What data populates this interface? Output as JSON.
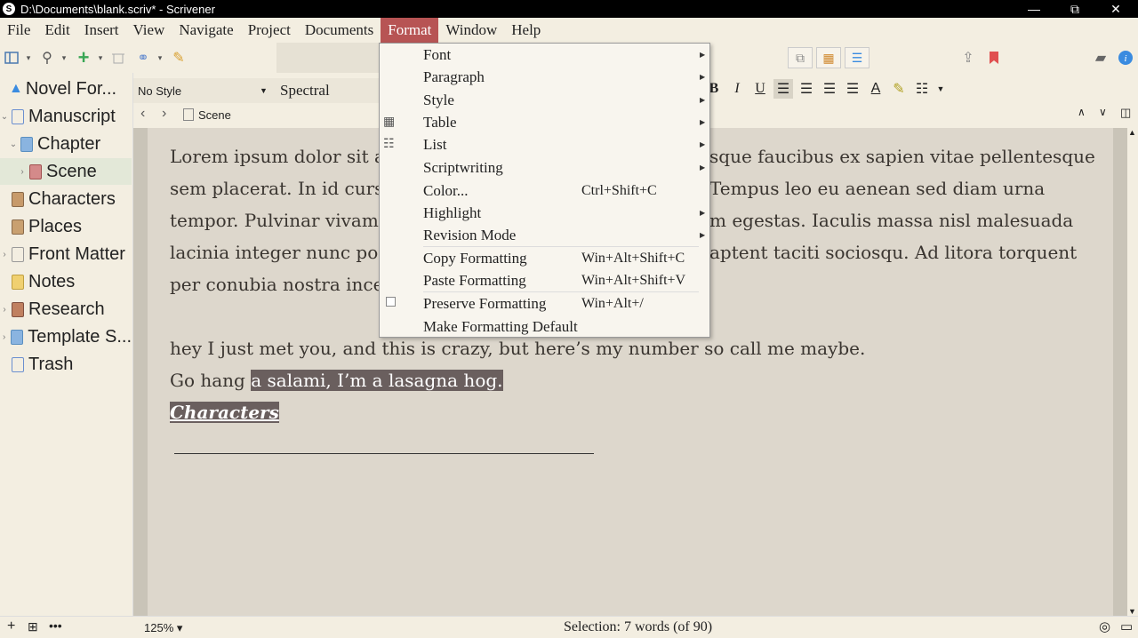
{
  "window": {
    "title": "D:\\Documents\\blank.scriv* - Scrivener",
    "minimize": "—",
    "maximize": "⧉",
    "close": "✕"
  },
  "menubar": [
    "File",
    "Edit",
    "Insert",
    "View",
    "Navigate",
    "Project",
    "Documents",
    "Format",
    "Window",
    "Help"
  ],
  "binder": {
    "items": [
      {
        "label": "Novel For...",
        "icon": "warning-icon"
      },
      {
        "label": "Manuscript",
        "icon": "folder-icon"
      },
      {
        "label": "Chapter",
        "icon": "folder-icon"
      },
      {
        "label": "Scene",
        "icon": "document-icon"
      },
      {
        "label": "Characters",
        "icon": "characters-icon"
      },
      {
        "label": "Places",
        "icon": "places-icon"
      },
      {
        "label": "Front Matter",
        "icon": "folder-icon"
      },
      {
        "label": "Notes",
        "icon": "notes-icon"
      },
      {
        "label": "Research",
        "icon": "research-icon"
      },
      {
        "label": "Template S...",
        "icon": "template-icon"
      },
      {
        "label": "Trash",
        "icon": "trash-icon"
      }
    ]
  },
  "formatbar": {
    "style": "No Style",
    "font": "Spectral"
  },
  "header": {
    "doc_title": "Scene"
  },
  "editor": {
    "lines": [
      "Lorem ipsum dolor sit a",
      "sem placerat. In id curs",
      "tempor. Pulvinar vivam",
      "lacinia integer nunc po",
      "per conubia nostra ince"
    ],
    "right_lines": [
      "sque faucibus ex sapien vitae pellentesque",
      "Tempus leo eu aenean sed diam urna",
      "m egestas. Iaculis massa nisl malesuada",
      "aptent taciti sociosqu. Ad litora torquent",
      ""
    ],
    "line_a": "hey I just met you, and this is crazy, but here’s my number so call me maybe.",
    "line_b_plain": "Go hang ",
    "line_b_selected": "a salami, I’m a lasagna hog.",
    "line_c": "Characters"
  },
  "footer": {
    "zoom": "125% ▾",
    "status": "Selection: 7 words (of 90)"
  },
  "format_menu": {
    "items": [
      {
        "label": "Font",
        "shortcut": "",
        "submenu": true
      },
      {
        "label": "Paragraph",
        "shortcut": "",
        "submenu": true
      },
      {
        "label": "Style",
        "shortcut": "",
        "submenu": true
      },
      {
        "label": "Table",
        "shortcut": "",
        "submenu": true,
        "icon": "table-icon"
      },
      {
        "label": "List",
        "shortcut": "",
        "submenu": true,
        "icon": "list-icon"
      },
      {
        "label": "Scriptwriting",
        "shortcut": "",
        "submenu": true
      },
      {
        "label": "Color...",
        "shortcut": "Ctrl+Shift+C",
        "submenu": false
      },
      {
        "label": "Highlight",
        "shortcut": "",
        "submenu": true
      },
      {
        "label": "Revision Mode",
        "shortcut": "",
        "submenu": true
      },
      {
        "label": "Copy Formatting",
        "shortcut": "Win+Alt+Shift+C",
        "submenu": false
      },
      {
        "label": "Paste Formatting",
        "shortcut": "Win+Alt+Shift+V",
        "submenu": false
      },
      {
        "label": "Preserve Formatting",
        "shortcut": "Win+Alt+/",
        "submenu": false,
        "checkbox": true
      },
      {
        "label": "Make Formatting Default",
        "shortcut": "",
        "submenu": false
      }
    ]
  },
  "colors": {
    "menu_active": "#b75454",
    "selection": "#6a5f5e",
    "editor_bg": "#ddd7cc",
    "chrome_bg": "#f3eee1"
  }
}
